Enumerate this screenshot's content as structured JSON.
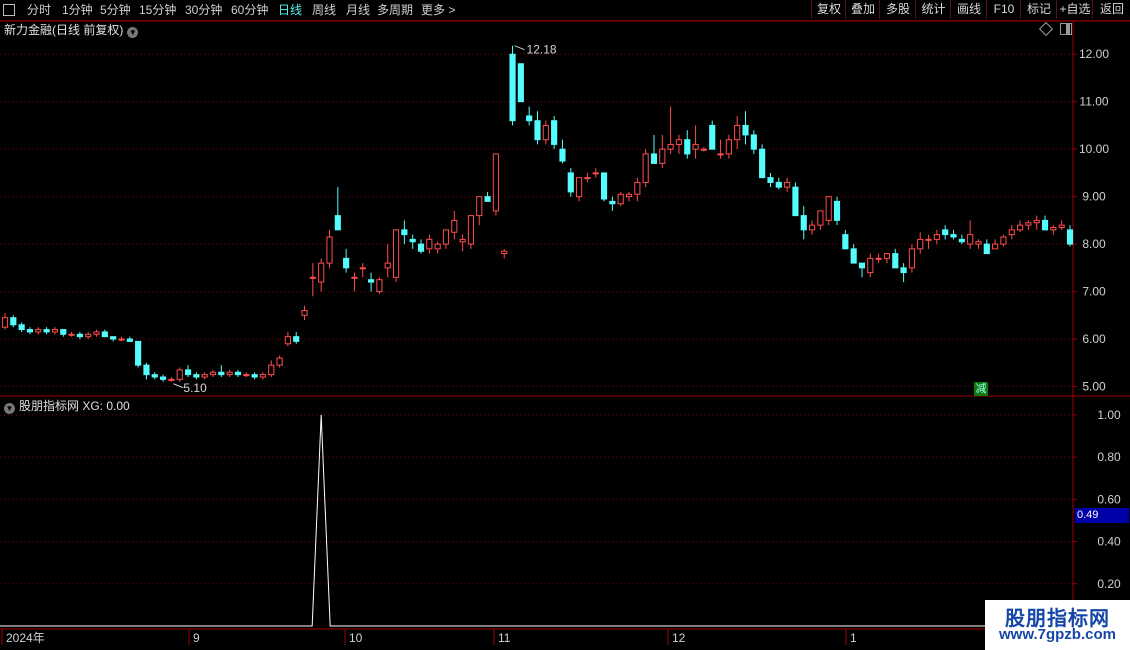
{
  "toolbar": {
    "periods": [
      "分时",
      "1分钟",
      "5分钟",
      "15分钟",
      "30分钟",
      "60分钟",
      "日线",
      "周线",
      "月线",
      "多周期",
      "更多 >"
    ],
    "active_period": "日线",
    "right_buttons": [
      "复权",
      "叠加",
      "多股",
      "统计",
      "画线",
      "F10",
      "标记",
      "+自选",
      "返回"
    ]
  },
  "stock": {
    "title": "新力金融(日线 前复权)",
    "price_axis": [
      "12.00",
      "11.00",
      "10.00",
      "9.00",
      "8.00",
      "7.00",
      "6.00",
      "5.00"
    ],
    "high_label": "12.18",
    "low_label": "5.10",
    "badge": "减"
  },
  "indicator": {
    "title": "股朋指标网  XG: 0.00",
    "axis": [
      "1.00",
      "0.80",
      "0.60",
      "0.40",
      "0.20"
    ],
    "current_value": "0.49"
  },
  "time_axis": [
    "2024年",
    "9",
    "10",
    "11",
    "12",
    "1"
  ],
  "brand": {
    "name": "股朋指标网",
    "url": "www.7gpzb.com"
  },
  "colors": {
    "up": "#ff4d4d",
    "down": "#54fcfc",
    "grid": "#7a0000",
    "frame": "#a00000",
    "line": "#ffffff"
  },
  "chart_data": {
    "type": "candlestick",
    "title": "新力金融(日线 前复权)",
    "y_range": [
      4.8,
      12.3
    ],
    "candles": [
      [
        6.25,
        6.55,
        6.2,
        6.45
      ],
      [
        6.45,
        6.5,
        6.25,
        6.3
      ],
      [
        6.3,
        6.35,
        6.15,
        6.2
      ],
      [
        6.2,
        6.25,
        6.1,
        6.15
      ],
      [
        6.15,
        6.25,
        6.1,
        6.2
      ],
      [
        6.2,
        6.25,
        6.1,
        6.15
      ],
      [
        6.15,
        6.25,
        6.1,
        6.2
      ],
      [
        6.2,
        6.2,
        6.05,
        6.1
      ],
      [
        6.1,
        6.15,
        6.05,
        6.1
      ],
      [
        6.1,
        6.15,
        6.0,
        6.05
      ],
      [
        6.05,
        6.15,
        6.0,
        6.1
      ],
      [
        6.1,
        6.2,
        6.05,
        6.15
      ],
      [
        6.15,
        6.2,
        6.05,
        6.05
      ],
      [
        6.05,
        6.05,
        5.95,
        6.0
      ],
      [
        6.0,
        6.05,
        5.95,
        6.0
      ],
      [
        6.0,
        6.05,
        5.95,
        5.95
      ],
      [
        5.95,
        5.95,
        5.4,
        5.45
      ],
      [
        5.45,
        5.5,
        5.15,
        5.25
      ],
      [
        5.25,
        5.3,
        5.15,
        5.2
      ],
      [
        5.2,
        5.25,
        5.1,
        5.15
      ],
      [
        5.15,
        5.2,
        5.1,
        5.15
      ],
      [
        5.15,
        5.4,
        5.1,
        5.35
      ],
      [
        5.35,
        5.45,
        5.2,
        5.25
      ],
      [
        5.25,
        5.3,
        5.15,
        5.2
      ],
      [
        5.2,
        5.3,
        5.15,
        5.25
      ],
      [
        5.25,
        5.35,
        5.2,
        5.3
      ],
      [
        5.3,
        5.45,
        5.2,
        5.25
      ],
      [
        5.25,
        5.35,
        5.2,
        5.3
      ],
      [
        5.3,
        5.35,
        5.2,
        5.25
      ],
      [
        5.25,
        5.3,
        5.2,
        5.25
      ],
      [
        5.25,
        5.3,
        5.15,
        5.2
      ],
      [
        5.2,
        5.3,
        5.15,
        5.25
      ],
      [
        5.25,
        5.55,
        5.2,
        5.45
      ],
      [
        5.45,
        5.65,
        5.4,
        5.6
      ],
      [
        5.9,
        6.15,
        5.85,
        6.05
      ],
      [
        6.05,
        6.15,
        5.9,
        5.95
      ],
      [
        6.5,
        6.7,
        6.4,
        6.6
      ],
      [
        7.3,
        7.6,
        6.9,
        7.3
      ],
      [
        7.2,
        7.7,
        7.0,
        7.6
      ],
      [
        7.6,
        8.3,
        7.5,
        8.15
      ],
      [
        8.6,
        9.2,
        8.4,
        8.3
      ],
      [
        7.7,
        7.9,
        7.4,
        7.5
      ],
      [
        7.3,
        7.4,
        7.0,
        7.3
      ],
      [
        7.5,
        7.6,
        7.3,
        7.5
      ],
      [
        7.25,
        7.4,
        7.0,
        7.2
      ],
      [
        7.0,
        7.3,
        6.95,
        7.25
      ],
      [
        7.5,
        8.0,
        7.3,
        7.6
      ],
      [
        7.3,
        8.3,
        7.2,
        8.3
      ],
      [
        8.3,
        8.5,
        8.0,
        8.2
      ],
      [
        8.1,
        8.2,
        7.9,
        8.05
      ],
      [
        8.0,
        8.1,
        7.8,
        7.85
      ],
      [
        7.9,
        8.2,
        7.8,
        8.1
      ],
      [
        7.9,
        8.05,
        7.8,
        8.0
      ],
      [
        8.0,
        8.3,
        7.9,
        8.3
      ],
      [
        8.25,
        8.7,
        8.1,
        8.5
      ],
      [
        8.05,
        8.2,
        7.85,
        8.1
      ],
      [
        8.0,
        8.6,
        7.9,
        8.6
      ],
      [
        8.6,
        9.0,
        8.4,
        9.0
      ],
      [
        9.0,
        9.1,
        8.9,
        8.9
      ],
      [
        8.7,
        9.9,
        8.6,
        9.9
      ],
      [
        7.8,
        7.9,
        7.7,
        7.85
      ],
      [
        12.0,
        12.18,
        10.5,
        10.6
      ],
      [
        11.8,
        11.8,
        11.0,
        11.0
      ],
      [
        10.7,
        10.9,
        10.5,
        10.6
      ],
      [
        10.6,
        10.8,
        10.1,
        10.2
      ],
      [
        10.2,
        10.6,
        10.1,
        10.5
      ],
      [
        10.6,
        10.7,
        10.0,
        10.1
      ],
      [
        10.0,
        10.2,
        9.7,
        9.75
      ],
      [
        9.5,
        9.6,
        9.0,
        9.1
      ],
      [
        9.0,
        9.4,
        8.9,
        9.4
      ],
      [
        9.4,
        9.5,
        9.3,
        9.4
      ],
      [
        9.5,
        9.6,
        9.4,
        9.5
      ],
      [
        9.5,
        9.5,
        8.9,
        8.95
      ],
      [
        8.9,
        9.0,
        8.7,
        8.85
      ],
      [
        8.85,
        9.1,
        8.8,
        9.05
      ],
      [
        9.0,
        9.1,
        8.9,
        9.05
      ],
      [
        9.05,
        9.4,
        8.9,
        9.3
      ],
      [
        9.3,
        10.0,
        9.2,
        9.9
      ],
      [
        9.9,
        10.3,
        9.7,
        9.7
      ],
      [
        9.7,
        10.3,
        9.6,
        10.0
      ],
      [
        10.0,
        10.9,
        9.9,
        10.1
      ],
      [
        10.1,
        10.3,
        9.9,
        10.2
      ],
      [
        10.2,
        10.4,
        9.8,
        9.9
      ],
      [
        10.0,
        10.5,
        9.8,
        10.1
      ],
      [
        10.0,
        10.05,
        9.95,
        10.0
      ],
      [
        10.5,
        10.6,
        10.0,
        10.0
      ],
      [
        9.9,
        10.2,
        9.8,
        9.9
      ],
      [
        9.9,
        10.3,
        9.8,
        10.2
      ],
      [
        10.2,
        10.7,
        10.0,
        10.5
      ],
      [
        10.5,
        10.8,
        10.1,
        10.3
      ],
      [
        10.3,
        10.4,
        9.9,
        10.0
      ],
      [
        10.0,
        10.1,
        9.4,
        9.4
      ],
      [
        9.4,
        9.5,
        9.2,
        9.3
      ],
      [
        9.3,
        9.4,
        9.15,
        9.2
      ],
      [
        9.2,
        9.4,
        9.1,
        9.3
      ],
      [
        9.2,
        9.3,
        8.6,
        8.6
      ],
      [
        8.6,
        8.8,
        8.1,
        8.3
      ],
      [
        8.3,
        8.5,
        8.2,
        8.4
      ],
      [
        8.4,
        8.7,
        8.3,
        8.7
      ],
      [
        8.5,
        9.0,
        8.4,
        9.0
      ],
      [
        8.9,
        9.0,
        8.4,
        8.5
      ],
      [
        8.2,
        8.3,
        7.9,
        7.9
      ],
      [
        7.9,
        8.0,
        7.6,
        7.6
      ],
      [
        7.6,
        7.6,
        7.3,
        7.5
      ],
      [
        7.4,
        7.8,
        7.3,
        7.7
      ],
      [
        7.7,
        7.8,
        7.6,
        7.7
      ],
      [
        7.7,
        7.8,
        7.6,
        7.8
      ],
      [
        7.8,
        7.9,
        7.6,
        7.5
      ],
      [
        7.5,
        7.6,
        7.2,
        7.4
      ],
      [
        7.5,
        8.0,
        7.4,
        7.9
      ],
      [
        7.9,
        8.25,
        7.8,
        8.1
      ],
      [
        8.1,
        8.2,
        7.9,
        8.1
      ],
      [
        8.1,
        8.3,
        8.0,
        8.2
      ],
      [
        8.3,
        8.4,
        8.1,
        8.2
      ],
      [
        8.2,
        8.3,
        8.1,
        8.15
      ],
      [
        8.1,
        8.2,
        8.0,
        8.05
      ],
      [
        8.0,
        8.5,
        7.9,
        8.2
      ],
      [
        8.0,
        8.1,
        7.9,
        8.05
      ],
      [
        8.0,
        8.1,
        7.8,
        7.8
      ],
      [
        7.9,
        8.1,
        7.9,
        8.0
      ],
      [
        8.0,
        8.2,
        7.95,
        8.15
      ],
      [
        8.2,
        8.4,
        8.1,
        8.3
      ],
      [
        8.3,
        8.5,
        8.25,
        8.4
      ],
      [
        8.4,
        8.5,
        8.3,
        8.45
      ],
      [
        8.45,
        8.6,
        8.3,
        8.5
      ],
      [
        8.5,
        8.6,
        8.4,
        8.3
      ],
      [
        8.3,
        8.4,
        8.2,
        8.35
      ],
      [
        8.35,
        8.5,
        8.3,
        8.4
      ],
      [
        8.3,
        8.4,
        7.95,
        8.0
      ]
    ],
    "indicator_series": {
      "name": "XG",
      "peak_index": 38,
      "peak_value": 1.0,
      "y_range": [
        0,
        1.08
      ]
    }
  }
}
